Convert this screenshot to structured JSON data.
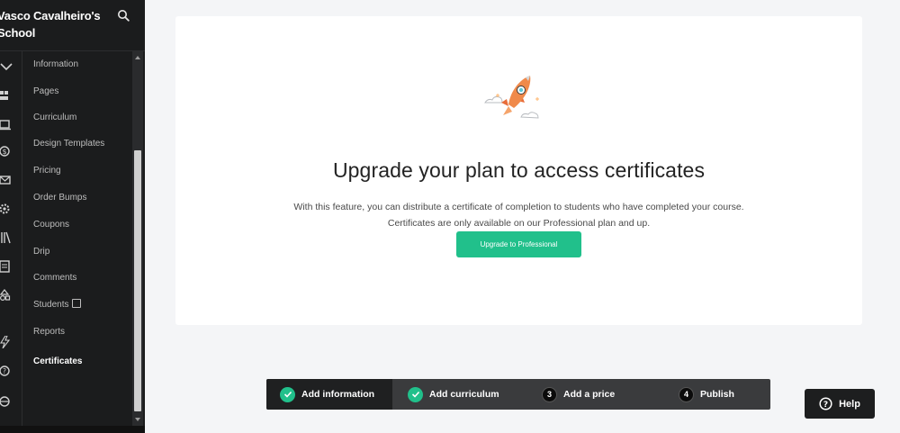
{
  "school": {
    "name": "Vasco Cavalheiro's School"
  },
  "rail_icons": [
    "chevron-down-icon",
    "dashboard-icon",
    "courses-icon",
    "sales-icon",
    "email-icon",
    "settings-icon",
    "library-icon",
    "reports-icon",
    "users-icon",
    "lightning-icon",
    "help-circle-icon",
    "lock-icon"
  ],
  "course_nav": {
    "items": [
      {
        "label": "Information"
      },
      {
        "label": "Pages"
      },
      {
        "label": "Curriculum"
      },
      {
        "label": "Design Templates"
      },
      {
        "label": "Pricing"
      },
      {
        "label": "Order Bumps"
      },
      {
        "label": "Coupons"
      },
      {
        "label": "Drip"
      },
      {
        "label": "Comments"
      },
      {
        "label": "Students"
      },
      {
        "label": "Reports"
      },
      {
        "label": "Certificates"
      }
    ],
    "active": "Certificates"
  },
  "card": {
    "title": "Upgrade your plan to access certificates",
    "desc_line1": "With this feature, you can distribute a certificate of completion to students who have completed your course.",
    "desc_line2": "Certificates are only available on our Professional plan and up.",
    "button_label": "Upgrade to Professional"
  },
  "stepper": {
    "steps": [
      {
        "label": "Add information",
        "status": "done"
      },
      {
        "label": "Add curriculum",
        "status": "done"
      },
      {
        "label": "Add a price",
        "number": "3"
      },
      {
        "label": "Publish",
        "number": "4"
      }
    ]
  },
  "help": {
    "label": "Help"
  },
  "colors": {
    "accent": "#21c08b",
    "sidebar_bg": "#1b1c1d",
    "stepper_bg": "#3a3b3d"
  }
}
